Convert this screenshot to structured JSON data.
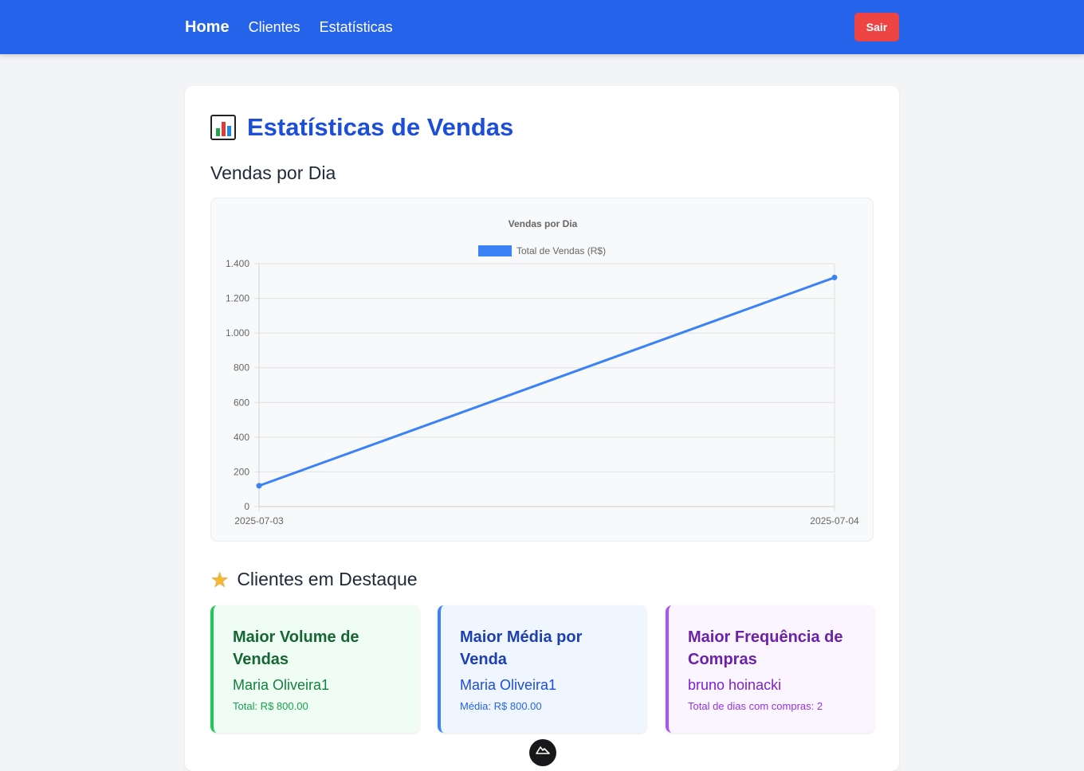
{
  "nav": {
    "home": "Home",
    "clients": "Clientes",
    "stats": "Estatísticas",
    "logout": "Sair"
  },
  "page": {
    "title": "Estatísticas de Vendas",
    "title_icon": "bar-chart-icon",
    "sales_section": "Vendas por Dia",
    "highlight_section": "Clientes em Destaque",
    "highlight_icon": "star-icon"
  },
  "chart_data": {
    "type": "line",
    "title": "Vendas por Dia",
    "x": [
      "2025-07-03",
      "2025-07-04"
    ],
    "series": [
      {
        "name": "Total de Vendas (R$)",
        "values": [
          120,
          1320
        ],
        "color": "#3b82f6"
      }
    ],
    "ylim": [
      0,
      1400
    ],
    "yticks": [
      "0",
      "200",
      "400",
      "600",
      "800",
      "1.000",
      "1.200",
      "1.400"
    ],
    "grid": true,
    "legend": "top"
  },
  "highlights": [
    {
      "title": "Maior Volume de Vendas",
      "name": "Maria Oliveira1",
      "detail": "Total: R$ 800.00",
      "color": "#22c55e"
    },
    {
      "title": "Maior Média por Venda",
      "name": "Maria Oliveira1",
      "detail": "Média: R$ 800.00",
      "color": "#3b82f6"
    },
    {
      "title": "Maior Frequência de Compras",
      "name": "bruno hoinacki",
      "detail": "Total de dias com compras: 2",
      "color": "#a855f7"
    }
  ]
}
